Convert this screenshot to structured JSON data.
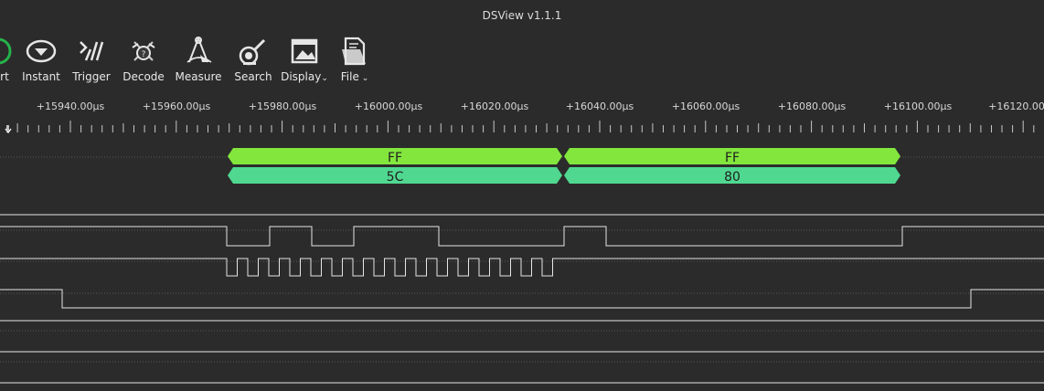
{
  "window": {
    "title": "DSView v1.1.1"
  },
  "toolbar": {
    "start_label": "rt",
    "instant_label": "Instant",
    "trigger_label": "Trigger",
    "decode_label": "Decode",
    "measure_label": "Measure",
    "search_label": "Search",
    "display_label": "Display",
    "file_label": "File"
  },
  "ruler": {
    "labels": [
      "+15940.00µs",
      "+15960.00µs",
      "+15980.00µs",
      "+16000.00µs",
      "+16020.00µs",
      "+16040.00µs",
      "+16060.00µs",
      "+16080.00µs",
      "+16100.00µs",
      "+16120.00"
    ]
  },
  "decoder": {
    "row1": [
      {
        "text": "FF"
      },
      {
        "text": "FF"
      }
    ],
    "row2": [
      {
        "text": "5C"
      },
      {
        "text": "80"
      }
    ]
  },
  "colors": {
    "background": "#2b2b2b",
    "decode_row1": "#82e63c",
    "decode_row2": "#50d890",
    "wave": "#e6e6e6",
    "start_ring": "#26b24a"
  }
}
